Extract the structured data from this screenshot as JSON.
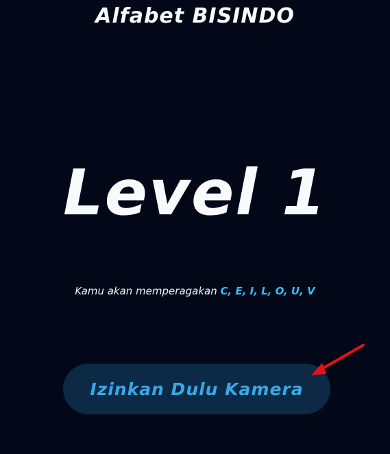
{
  "header": {
    "title": "Alfabet BISINDO"
  },
  "main": {
    "level_title": "Level 1",
    "subtitle_prefix": "Kamu akan memperagakan",
    "subtitle_letters": "C, E, I, L, O, U, V",
    "camera_button_label": "Izinkan Dulu Kamera"
  },
  "annotation": {
    "arrow_icon": "red-arrow-icon",
    "arrow_color": "#e3121a"
  },
  "colors": {
    "background": "#020817",
    "accent": "#38bdf8",
    "button_bg": "#0c2a45"
  }
}
